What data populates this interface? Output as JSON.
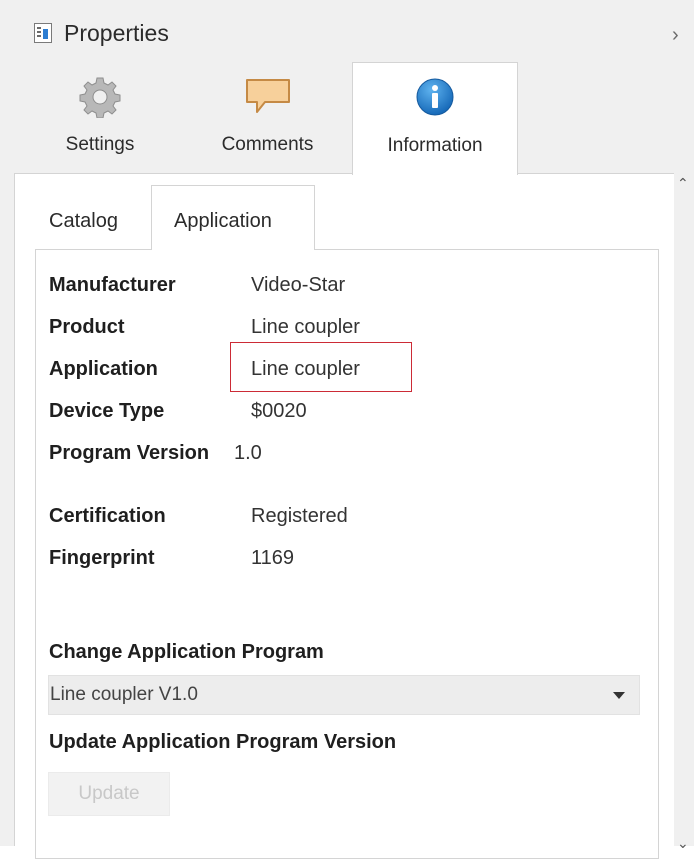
{
  "header": {
    "title": "Properties",
    "title_icon": "properties-document-icon",
    "collapse_icon": "chevron-right-icon"
  },
  "main_tabs": [
    {
      "label": "Settings",
      "icon": "gear-icon"
    },
    {
      "label": "Comments",
      "icon": "comment-bubble-icon"
    },
    {
      "label": "Information",
      "icon": "info-icon",
      "active": true
    }
  ],
  "sub_tabs": [
    {
      "label": "Catalog"
    },
    {
      "label": "Application",
      "active": true
    }
  ],
  "fields": [
    {
      "key": "Manufacturer",
      "value": "Video-Star"
    },
    {
      "key": "Product",
      "value": "Line coupler"
    },
    {
      "key": "Application",
      "value": "Line coupler"
    },
    {
      "key": "Device Type",
      "value": "$0020"
    },
    {
      "key": "Program Version",
      "value": "1.0"
    },
    {
      "key": "Certification",
      "value": "Registered"
    },
    {
      "key": "Fingerprint",
      "value": "1169"
    }
  ],
  "change_program": {
    "label": "Change Application Program",
    "selected": "Line coupler V1.0"
  },
  "update_version": {
    "label": "Update Application Program Version",
    "button_label": "Update"
  },
  "colors": {
    "highlight": "#cc2b36",
    "info_blue": "#1e7fd0",
    "comment_orange": "#f5c98a"
  }
}
